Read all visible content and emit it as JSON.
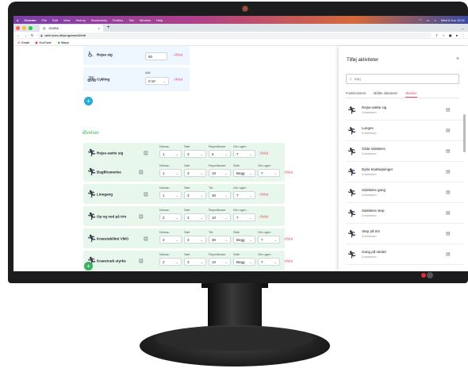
{
  "menubar": {
    "items": [
      "Chrome",
      "File",
      "Edit",
      "View",
      "History",
      "Bookmarks",
      "Profiles",
      "Tab",
      "Window",
      "Help"
    ],
    "clock": "Wed 8 Jun 10.01"
  },
  "browser": {
    "tab_title": "ICURA",
    "url": "web.icura.dk/programs/4/edit",
    "bookmarks": [
      "Gmail",
      "YouTube",
      "Maps"
    ]
  },
  "activities": [
    {
      "name": "Rejse sig",
      "icon": "sit-to-stand-icon",
      "value": "50",
      "end_label": "Afslut",
      "has_label": false
    },
    {
      "name": "Cykling",
      "icon": "cycling-icon",
      "label": "Mål",
      "value": "0:10",
      "end_label": "Afslut",
      "has_label": true
    }
  ],
  "exercises_title": "Øvelser",
  "exercises": [
    {
      "name": "Rejse-sætte sig",
      "f": [
        [
          "Niveau",
          "1"
        ],
        [
          "Sæt",
          "3"
        ],
        [
          "Repetitioner",
          "5"
        ],
        [
          "Om ugen",
          "7"
        ]
      ],
      "end": "Afslut"
    },
    {
      "name": "Bagfilrsøvelse",
      "f": [
        [
          "Niveau",
          "1"
        ],
        [
          "Sæt",
          "3"
        ],
        [
          "Repetitioner",
          "10"
        ],
        [
          "Side",
          "Begg"
        ],
        [
          "Om ugen",
          "7"
        ]
      ],
      "end": "Afslut"
    },
    {
      "name": "Linegang",
      "f": [
        [
          "Niveau",
          "1"
        ],
        [
          "Sæt",
          "3"
        ],
        [
          "Tid",
          "30"
        ],
        [
          "Om ugen",
          "7"
        ]
      ],
      "end": "Afslut"
    },
    {
      "name": "Op og ned på trin",
      "f": [
        [
          "Niveau",
          "2"
        ],
        [
          "Sæt",
          "3"
        ],
        [
          "Repetitioner",
          "10"
        ],
        [
          "Om ugen",
          "7"
        ]
      ],
      "end": "Afslut"
    },
    {
      "name": "Knæstabilitet VMO",
      "f": [
        [
          "Niveau",
          "2"
        ],
        [
          "Sæt",
          "3"
        ],
        [
          "Tid",
          "30"
        ],
        [
          "Side",
          "Begg"
        ],
        [
          "Om ugen",
          "7"
        ]
      ],
      "end": "Afslut"
    },
    {
      "name": "Knæstræk styrke",
      "f": [
        [
          "Niveau",
          "2"
        ],
        [
          "Sæt",
          "3"
        ],
        [
          "Repetitioner",
          "10"
        ],
        [
          "Side",
          "Begg"
        ],
        [
          "Om ugen",
          "7"
        ]
      ],
      "end": "Afslut"
    }
  ],
  "panel": {
    "title": "Tilføj aktiviteter",
    "search_placeholder": "Søg",
    "tabs": [
      "Funktionstest",
      "Måltte aktiviteter",
      "Øvelser"
    ],
    "active_tab": 2,
    "items": [
      {
        "name": "Rejse-sætte sig",
        "duration": "3 minimum",
        "icon": "sit-to-stand-icon"
      },
      {
        "name": "Lunges",
        "duration": "3 minimum",
        "icon": "lunge-icon"
      },
      {
        "name": "Glide sidelæns",
        "duration": "3 minimum",
        "icon": "slide-icon"
      },
      {
        "name": "Dybe knæbøjninger",
        "duration": "3 minimum",
        "icon": "squat-icon"
      },
      {
        "name": "Sidelæns gang",
        "duration": "3 minimum",
        "icon": "walk-icon"
      },
      {
        "name": "Sidelæns step",
        "duration": "3 minimum",
        "icon": "step-icon"
      },
      {
        "name": "Step på trin",
        "duration": "3 minimum",
        "icon": "step-up-icon"
      },
      {
        "name": "Gang på stedet",
        "duration": "3 minimum",
        "icon": "march-icon"
      }
    ]
  },
  "colors": {
    "accent": "#e04a6a",
    "exercise_green": "#3ab060",
    "activity_blue": "#2aa8e0"
  }
}
